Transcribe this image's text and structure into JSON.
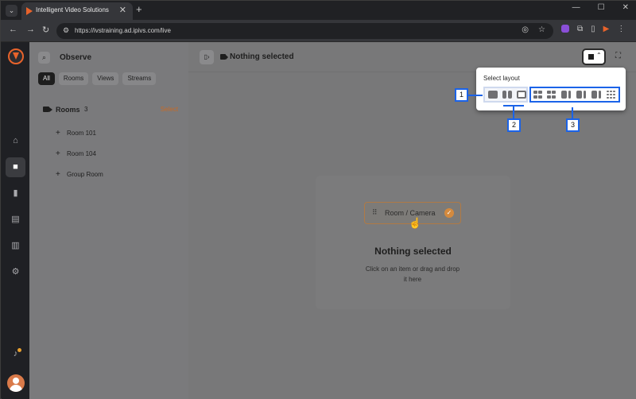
{
  "browser": {
    "tab_title": "Intelligent Video Solutions",
    "tab_close": "✕",
    "new_tab": "+",
    "url": "https://ivstraining.ad.ipivs.com/live",
    "window_controls": [
      "—",
      "☐",
      "✕"
    ]
  },
  "sidebar": {
    "title": "Observe",
    "filters": [
      "All",
      "Rooms",
      "Views",
      "Streams"
    ],
    "active_filter": "All",
    "section_label": "Rooms",
    "section_count": "3",
    "select_label": "Select",
    "rooms": [
      "Room 101",
      "Room 104",
      "Group Room"
    ]
  },
  "rail": {
    "icons": [
      "home-icon",
      "camera-icon",
      "film-icon",
      "report-icon",
      "chart-icon",
      "settings-icon",
      "bell-icon",
      "avatar"
    ]
  },
  "main": {
    "title": "Nothing selected",
    "chip_label": "Room / Camera",
    "empty_title": "Nothing selected",
    "empty_desc": "Click on an item or drag and drop it here"
  },
  "layout_popup": {
    "title": "Select layout",
    "callouts": [
      "1",
      "2",
      "3"
    ]
  },
  "colors": {
    "accent": "#e8632b",
    "callout_blue": "#1b63e8",
    "select_link": "#c86a25"
  }
}
